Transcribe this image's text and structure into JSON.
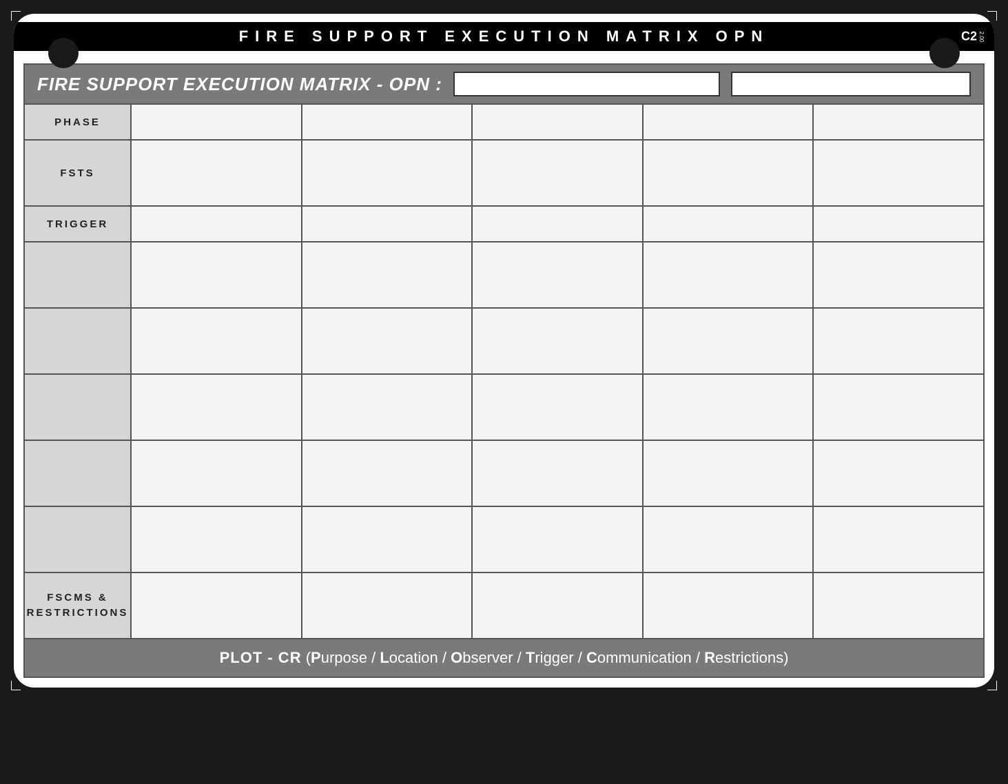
{
  "top_bar": {
    "title": "FIRE SUPPORT EXECUTION MATRIX OPN",
    "brand_mark": "C2",
    "brand_version": "2.00"
  },
  "header": {
    "title": "FIRE SUPPORT EXECUTION MATRIX - OPN :",
    "field1": "",
    "field2": ""
  },
  "rows": {
    "phase": "PHASE",
    "fsts": "FSTS",
    "trigger": "TRIGGER",
    "body1": "",
    "body2": "",
    "body3": "",
    "body4": "",
    "body5": "",
    "fscms": "FSCMS & RESTRICTIONS"
  },
  "columns": [
    "",
    "",
    "",
    "",
    ""
  ],
  "footer": {
    "lead": "PLOT - CR",
    "open": " (",
    "p": "P",
    "p_rest": "urpose / ",
    "l": "L",
    "l_rest": "ocation / ",
    "o": "O",
    "o_rest": "bserver / ",
    "t": "T",
    "t_rest": "rigger / ",
    "c": "C",
    "c_rest": "ommunication / ",
    "r": "R",
    "r_rest": "estrictions)",
    "close": ""
  }
}
